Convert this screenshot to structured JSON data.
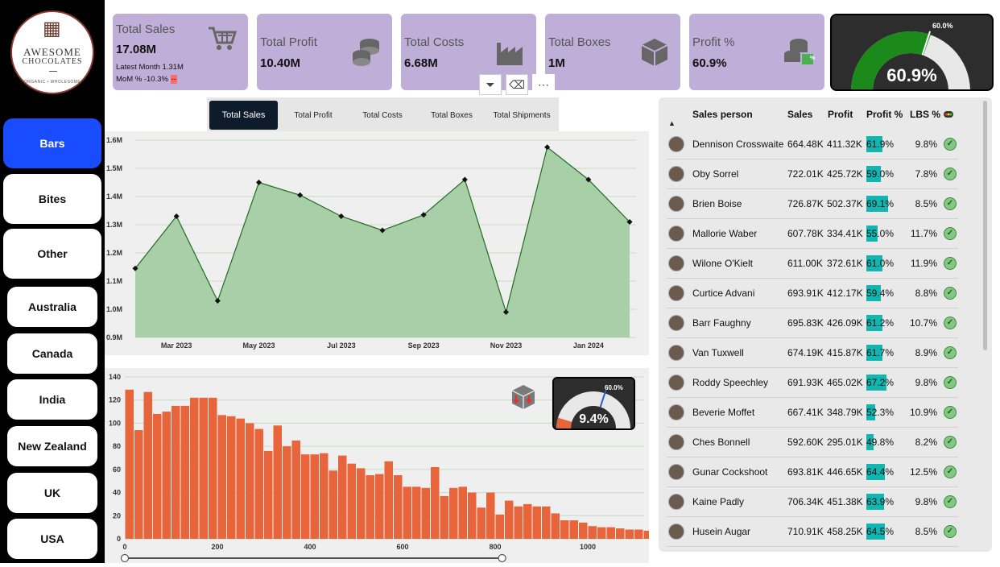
{
  "logo": {
    "line1": "AWESOME",
    "line2": "CHOCOLATES",
    "tagline": "ORGANIC • WHOLESOME"
  },
  "nav": [
    "Bars",
    "Bites",
    "Other",
    "Australia",
    "Canada",
    "India",
    "New Zealand",
    "UK",
    "USA"
  ],
  "kpis": {
    "sales": {
      "label": "Total Sales",
      "value": "17.08M",
      "latest": "Latest Month 1.31M",
      "mom": "MoM % -10.3%",
      "mom_flag": "--"
    },
    "profit": {
      "label": "Total Profit",
      "value": "10.40M"
    },
    "costs": {
      "label": "Total Costs",
      "value": "6.68M"
    },
    "boxes": {
      "label": "Total Boxes",
      "value": "1M"
    },
    "profit_pct": {
      "label": "Profit %",
      "value": "60.9%",
      "badge": "%"
    }
  },
  "gauge_main": {
    "value": "60.9%",
    "target": "60.0%",
    "fraction": 0.609
  },
  "tabs": [
    "Total Sales",
    "Total Profit",
    "Total Costs",
    "Total Boxes",
    "Total Shipments"
  ],
  "toolbar": {
    "filter": "⏷",
    "eraser": "⌫",
    "more": "⋯"
  },
  "gauge_small": {
    "value": "9.4%",
    "target": "60.0%",
    "fraction": 0.094
  },
  "table": {
    "headers": [
      "Sales person",
      "Sales",
      "Profit",
      "Profit %",
      "LBS %"
    ],
    "rows": [
      {
        "name": "Dennison Crosswaite",
        "sales": "664.48K",
        "profit": "411.32K",
        "pct": "61.9%",
        "pct_val": 61.9,
        "lbs": "9.8%"
      },
      {
        "name": "Oby Sorrel",
        "sales": "722.01K",
        "profit": "425.72K",
        "pct": "59.0%",
        "pct_val": 59.0,
        "lbs": "7.8%"
      },
      {
        "name": "Brien Boise",
        "sales": "726.87K",
        "profit": "502.37K",
        "pct": "69.1%",
        "pct_val": 69.1,
        "lbs": "8.5%"
      },
      {
        "name": "Mallorie Waber",
        "sales": "607.78K",
        "profit": "334.41K",
        "pct": "55.0%",
        "pct_val": 55.0,
        "lbs": "11.7%"
      },
      {
        "name": "Wilone O'Kielt",
        "sales": "611.00K",
        "profit": "372.61K",
        "pct": "61.0%",
        "pct_val": 61.0,
        "lbs": "11.9%"
      },
      {
        "name": "Curtice Advani",
        "sales": "693.91K",
        "profit": "412.17K",
        "pct": "59.4%",
        "pct_val": 59.4,
        "lbs": "8.8%"
      },
      {
        "name": "Barr Faughny",
        "sales": "695.83K",
        "profit": "426.09K",
        "pct": "61.2%",
        "pct_val": 61.2,
        "lbs": "10.7%"
      },
      {
        "name": "Van Tuxwell",
        "sales": "674.19K",
        "profit": "415.87K",
        "pct": "61.7%",
        "pct_val": 61.7,
        "lbs": "8.9%"
      },
      {
        "name": "Roddy Speechley",
        "sales": "691.93K",
        "profit": "465.02K",
        "pct": "67.2%",
        "pct_val": 67.2,
        "lbs": "9.8%"
      },
      {
        "name": "Beverie Moffet",
        "sales": "667.41K",
        "profit": "348.79K",
        "pct": "52.3%",
        "pct_val": 52.3,
        "lbs": "10.9%"
      },
      {
        "name": "Ches Bonnell",
        "sales": "592.60K",
        "profit": "295.01K",
        "pct": "49.8%",
        "pct_val": 49.8,
        "lbs": "8.2%"
      },
      {
        "name": "Gunar Cockshoot",
        "sales": "693.81K",
        "profit": "446.65K",
        "pct": "64.4%",
        "pct_val": 64.4,
        "lbs": "12.5%"
      },
      {
        "name": "Kaine Padly",
        "sales": "706.34K",
        "profit": "451.38K",
        "pct": "63.9%",
        "pct_val": 63.9,
        "lbs": "9.8%"
      },
      {
        "name": "Husein Augar",
        "sales": "710.91K",
        "profit": "458.25K",
        "pct": "64.5%",
        "pct_val": 64.5,
        "lbs": "8.5%"
      }
    ]
  },
  "colors": {
    "area_fill": "#a9cfa9",
    "area_line": "#1f6b1f",
    "bar": "#e8643a",
    "kpi_bg": "#bfaed7",
    "accent": "#1a4cff",
    "teal": "#12b5b0"
  },
  "chart_data": [
    {
      "type": "area",
      "x": [
        "Feb 2023",
        "Mar 2023",
        "Apr 2023",
        "May 2023",
        "Jun 2023",
        "Jul 2023",
        "Aug 2023",
        "Sep 2023",
        "Oct 2023",
        "Nov 2023",
        "Dec 2023",
        "Jan 2024",
        "Feb 2024"
      ],
      "y": [
        1.145,
        1.33,
        1.03,
        1.45,
        1.405,
        1.33,
        1.28,
        1.335,
        1.46,
        0.99,
        1.575,
        1.46,
        1.31
      ],
      "xticks": [
        "Mar 2023",
        "May 2023",
        "Jul 2023",
        "Sep 2023",
        "Nov 2023",
        "Jan 2024"
      ],
      "yticks": [
        "0.9M",
        "1.0M",
        "1.1M",
        "1.2M",
        "1.3M",
        "1.4M",
        "1.5M",
        "1.6M"
      ],
      "ylim": [
        0.9,
        1.6
      ],
      "grid": true
    },
    {
      "type": "bar",
      "xticks": [
        0,
        200,
        400,
        600,
        800,
        1000
      ],
      "yticks": [
        0,
        20,
        40,
        60,
        80,
        100,
        120,
        140
      ],
      "xlim": [
        0,
        1120
      ],
      "ylim": [
        0,
        140
      ],
      "bin_width": 20,
      "values": [
        129,
        94,
        127,
        108,
        110,
        115,
        115,
        122,
        122,
        122,
        107,
        106,
        104,
        100,
        95,
        76,
        98,
        80,
        85,
        73,
        73,
        74,
        59,
        72,
        65,
        61,
        55,
        56,
        67,
        55,
        45,
        45,
        44,
        62,
        37,
        44,
        45,
        40,
        27,
        40,
        21,
        33,
        28,
        30,
        28,
        28,
        22,
        16,
        16,
        14,
        11,
        10,
        10,
        9,
        8,
        8,
        7,
        8,
        7,
        6,
        9,
        6,
        8
      ]
    }
  ]
}
